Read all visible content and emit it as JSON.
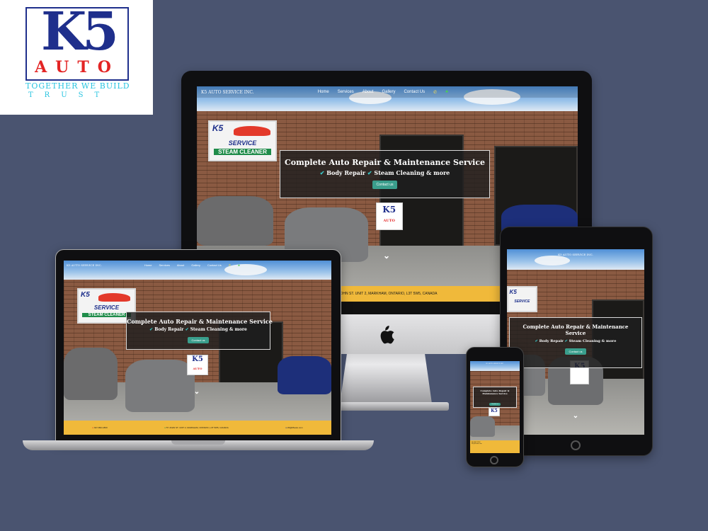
{
  "logo": {
    "mark": "K5",
    "word": "AUTO",
    "tagline": "TOGETHER WE BUILD",
    "trust": "TRUST",
    "colors": {
      "mark": "#1f2f8c",
      "word": "#e32424",
      "tagline": "#28c4e0"
    }
  },
  "site": {
    "brand": "K5 AUTO SERVICE INC.",
    "nav": [
      "Home",
      "Services",
      "About",
      "Gallery",
      "Contact Us"
    ],
    "hero_title": "Complete Auto Repair & Maintenance Service",
    "hero_items": [
      "Body Repair",
      "Steam Cleaning & more"
    ],
    "cta": "Contact us",
    "sign_k5": "K5",
    "sign_auto": "AUTO",
    "sign_service": "SERVICE",
    "sign_steam": "STEAM CLEANER",
    "footer_address_partial": "JOHN ST. UNIT 2, MARKHAM, ONTARIO, L3T 5W5, CANADA",
    "footer_phone": "647-862-1800",
    "footer_address": "57 JOHN ST. UNIT 2, MARKHAM, ONTARIO, L3T 5W5, CANADA",
    "footer_email": "k5@k5auto.com"
  },
  "colors": {
    "background": "#4a5470",
    "accent": "#3a9e8c",
    "footer": "#f0b93a",
    "check": "#38c3c3"
  }
}
